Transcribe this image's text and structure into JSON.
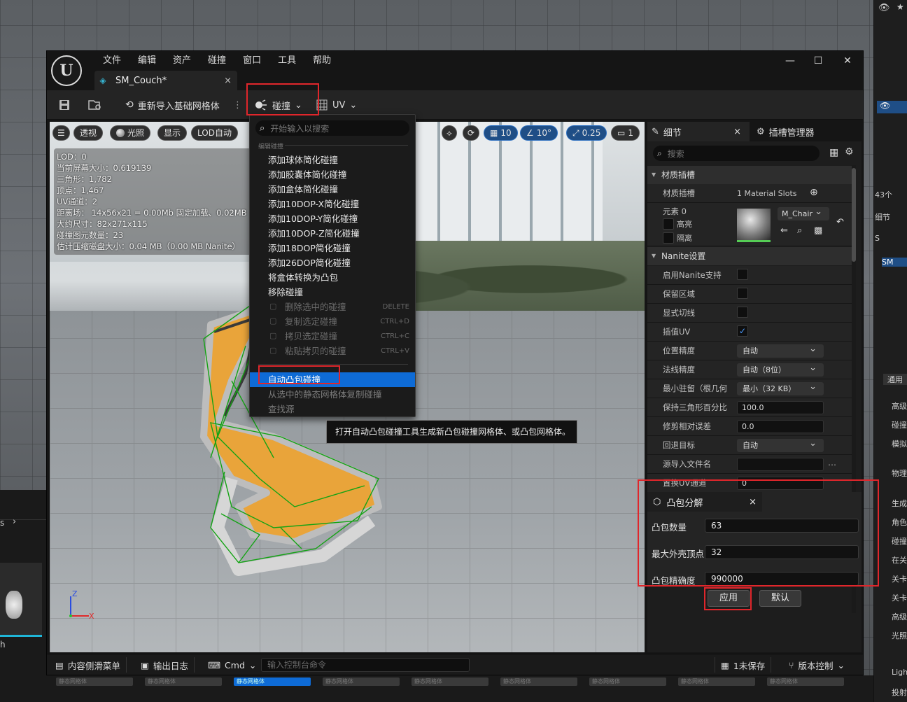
{
  "menu": [
    "文件",
    "编辑",
    "资产",
    "碰撞",
    "窗口",
    "工具",
    "帮助"
  ],
  "tab": {
    "title": "SM_Couch*",
    "close": "×"
  },
  "window_controls": {
    "minimize": "—",
    "maximize": "☐",
    "close": "✕"
  },
  "toolbar": {
    "reimport": "重新导入基础网格体",
    "collision": "碰撞",
    "uv": "UV"
  },
  "viewport": {
    "chips": [
      "透视",
      "光照",
      "显示",
      "LOD自动"
    ],
    "right_chips": {
      "grid": "10",
      "angle": "10°",
      "scale": "0.25",
      "camera": "1"
    },
    "stats": [
      "LOD：0",
      "当前屏幕大小：0.619139",
      "三角形：1,782",
      "顶点：1,467",
      "UV通道：2",
      "距离场： 14x56x21 = 0.00Mb 固定加载、0.02MB",
      "大约尺寸：82x271x115",
      "碰撞图元数量：23",
      "估计压缩磁盘大小：0.04 MB（0.00 MB Nanite）"
    ],
    "axis_labels": {
      "x": "X",
      "z": "Z"
    }
  },
  "dropdown": {
    "search_placeholder": "开始输入以搜索",
    "section": "编辑碰撞",
    "items": [
      "添加球体简化碰撞",
      "添加胶囊体简化碰撞",
      "添加盒体简化碰撞",
      "添加10DOP-X简化碰撞",
      "添加10DOP-Y简化碰撞",
      "添加10DOP-Z简化碰撞",
      "添加18DOP简化碰撞",
      "添加26DOP简化碰撞",
      "将盒体转换为凸包",
      "移除碰撞"
    ],
    "disabled_items": [
      {
        "label": "删除选中的碰撞",
        "shortcut": "DELETE"
      },
      {
        "label": "复制选定碰撞",
        "shortcut": "CTRL+D"
      },
      {
        "label": "拷贝选定碰撞",
        "shortcut": "CTRL+C"
      },
      {
        "label": "粘贴拷贝的碰撞",
        "shortcut": "CTRL+V"
      }
    ],
    "highlighted": "自动凸包碰撞",
    "after": [
      "从选中的静态网格体复制碰撞",
      "查找源"
    ]
  },
  "tooltip": "打开自动凸包碰撞工具生成新凸包碰撞网格体、或凸包网格体。",
  "details": {
    "tab_details": "细节",
    "tab_sockets": "插槽管理器",
    "search_placeholder": "搜索",
    "material_section": "材质插槽",
    "material_label": "材质插槽",
    "material_count": "1 Material Slots",
    "element": "元素 0",
    "highlight": "高亮",
    "isolate": "隔离",
    "material_name": "M_Chair",
    "nanite_section": "Nanite设置",
    "rows": [
      {
        "label": "启用Nanite支持",
        "type": "check",
        "value": ""
      },
      {
        "label": "保留区域",
        "type": "check",
        "value": ""
      },
      {
        "label": "显式切线",
        "type": "check",
        "value": ""
      },
      {
        "label": "插值UV",
        "type": "check",
        "value": "✓"
      },
      {
        "label": "位置精度",
        "type": "combo",
        "value": "自动"
      },
      {
        "label": "法线精度",
        "type": "combo",
        "value": "自动（8位）"
      },
      {
        "label": "最小驻留（根几何体）",
        "type": "combo",
        "value": "最小（32 KB）"
      },
      {
        "label": "保持三角形百分比",
        "type": "num",
        "value": "100.0"
      },
      {
        "label": "修剪相对误差",
        "type": "num",
        "value": "0.0"
      },
      {
        "label": "回退目标",
        "type": "combo",
        "value": "自动"
      },
      {
        "label": "源导入文件名",
        "type": "num",
        "value": ""
      },
      {
        "label": "置换UV通道",
        "type": "num",
        "value": "0"
      }
    ]
  },
  "convex": {
    "title": "凸包分解",
    "close": "×",
    "hull_count_label": "凸包数量",
    "hull_count": "63",
    "max_verts_label": "最大外壳顶点",
    "max_verts": "32",
    "precision_label": "凸包精确度",
    "precision": "990000",
    "apply": "应用",
    "default": "默认"
  },
  "statusbar": {
    "content_drawer": "内容侧滑菜单",
    "output_log": "输出日志",
    "cmd": "Cmd",
    "console_placeholder": "输入控制台命令",
    "unsaved": "1未保存",
    "version_control": "版本控制"
  },
  "background": {
    "bottom_tiles": [
      "静态网格体",
      "静态网格体",
      "静态网格体",
      "静态网格体",
      "静态网格体",
      "静态网格体",
      "静态网格体",
      "静态网格体",
      "静态网格体"
    ],
    "right_labels": [
      "43个",
      "细节",
      "S",
      "SM",
      "通用",
      "高级",
      "碰撞",
      "模拟",
      "物理",
      "生成",
      "角色",
      "碰撞",
      "在关",
      "关卡",
      "关卡",
      "高级",
      "光照",
      "Ligh",
      "投射"
    ],
    "left_labels": [
      "s",
      "h"
    ]
  }
}
